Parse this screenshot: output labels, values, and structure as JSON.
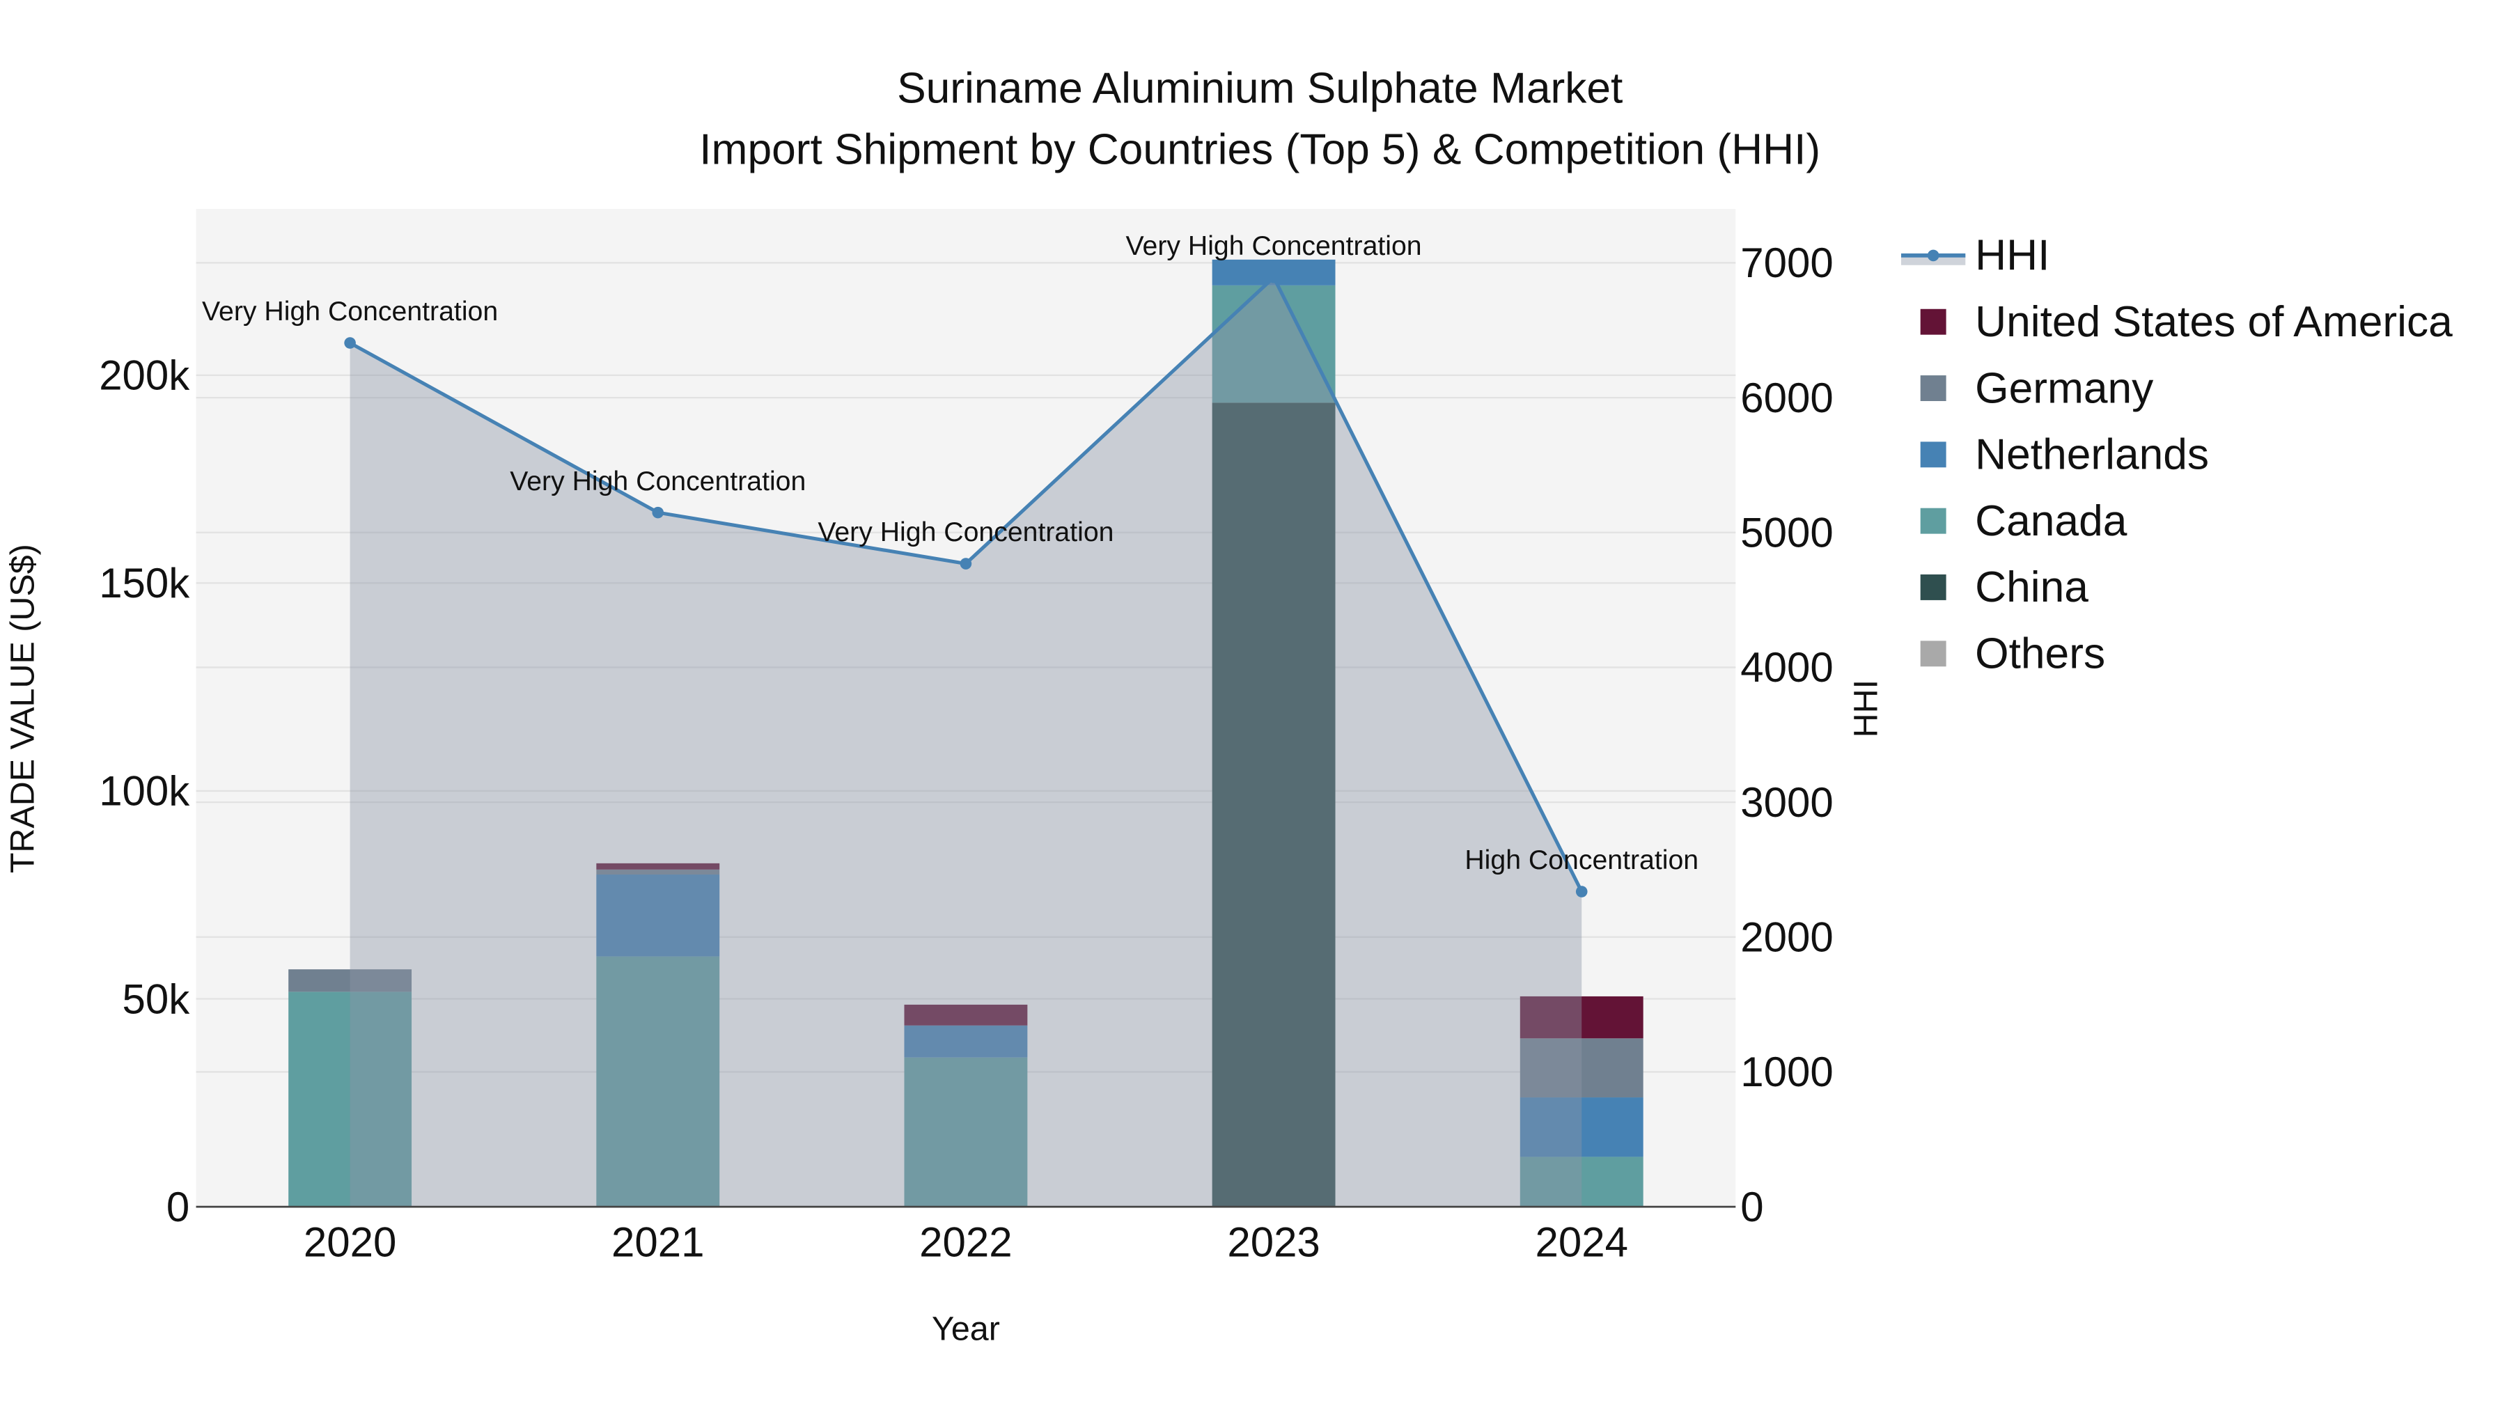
{
  "chart_data": {
    "type": "bar",
    "title": "Suriname Aluminium Sulphate Market",
    "subtitle": "Import Shipment by Countries (Top 5) & Competition (HHI)",
    "xlabel": "Year",
    "ylabel": "TRADE VALUE (US$)",
    "y2label": "HHI",
    "categories": [
      "2020",
      "2021",
      "2022",
      "2023",
      "2024"
    ],
    "ylim": [
      0,
      240000
    ],
    "y2lim": [
      0,
      7400
    ],
    "yticks": [
      0,
      50000,
      100000,
      150000,
      200000
    ],
    "ytick_labels": [
      "0",
      "50k",
      "100k",
      "150k",
      "200k"
    ],
    "y2ticks": [
      0,
      1000,
      2000,
      3000,
      4000,
      5000,
      6000,
      7000
    ],
    "y2tick_labels": [
      "0",
      "1000",
      "2000",
      "3000",
      "4000",
      "5000",
      "6000",
      "7000"
    ],
    "grid": true,
    "legend_position": "right",
    "series": [
      {
        "name": "China",
        "color": "#2F4F4F",
        "values": [
          0,
          0,
          0,
          193400,
          0
        ]
      },
      {
        "name": "Canada",
        "color": "#5F9EA0",
        "values": [
          51700,
          60200,
          35900,
          28200,
          12000
        ]
      },
      {
        "name": "Netherlands",
        "color": "#4682B4",
        "values": [
          0,
          19700,
          7700,
          6200,
          14300
        ]
      },
      {
        "name": "Germany",
        "color": "#708090",
        "values": [
          5400,
          1200,
          0,
          0,
          14200
        ]
      },
      {
        "name": "United States of America",
        "color": "#631336",
        "values": [
          0,
          1500,
          5000,
          0,
          10100
        ]
      },
      {
        "name": "Others",
        "color": "#A9A9A9",
        "values": [
          0,
          0,
          0,
          0,
          0
        ]
      }
    ],
    "hhi": {
      "name": "HHI",
      "color": "#4682B4",
      "values": [
        6406,
        5148,
        4769,
        6892,
        2337
      ],
      "annotations": [
        "Very High Concentration",
        "Very High Concentration",
        "Very High Concentration",
        "Very High Concentration",
        "High Concentration"
      ]
    },
    "legend_order": [
      "HHI",
      "United States of America",
      "Germany",
      "Netherlands",
      "Canada",
      "China",
      "Others"
    ]
  }
}
